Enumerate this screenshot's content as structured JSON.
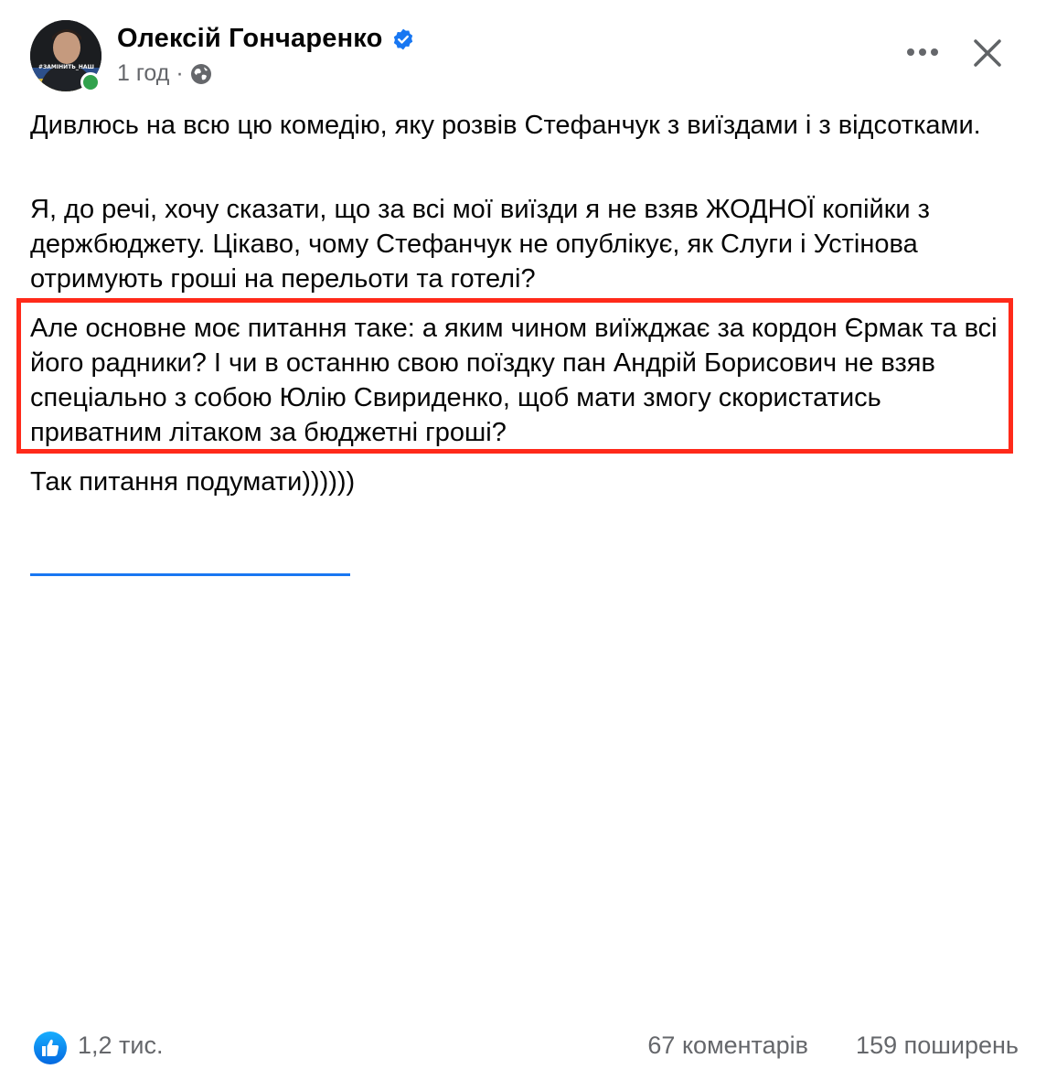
{
  "post": {
    "author": "Олексій Гончаренко",
    "time": "1 год",
    "meta_separator": "·",
    "avatar_caption": "#ЗАМІНИТЬ_НАШ",
    "paragraphs": [
      "Дивлюсь на всю цю комедію, яку розвів Стефанчук з виїздами і з відсотками.",
      "Я, до речі, хочу сказати, що за всі мої виїзди я не взяв ЖОДНОЇ копійки з держбюджету. Цікаво, чому Стефанчук не опублікує, як Слуги і Устінова отримують гроші на перельоти та готелі?",
      "Але основне моє питання таке: а яким чином виїжджає за кордон Єрмак та всі його радники? І чи в останню свою поїздку пан Андрій Борисович не взяв спеціально з собою Юлію Свириденко, щоб мати змогу скористатись приватним літаком за бюджетні гроші?",
      "Так питання подумати))))))"
    ]
  },
  "stats": {
    "likes": "1,2 тис.",
    "comments": "67 коментарів",
    "shares": "159 поширень"
  },
  "colors": {
    "highlight_border": "#ff2a1a",
    "facebook_blue": "#1877f2",
    "secondary_text": "#65676b",
    "online_green": "#31a24c"
  },
  "icons": [
    "verified-badge-icon",
    "globe-icon",
    "more-options-icon",
    "close-icon",
    "like-reaction-icon"
  ]
}
